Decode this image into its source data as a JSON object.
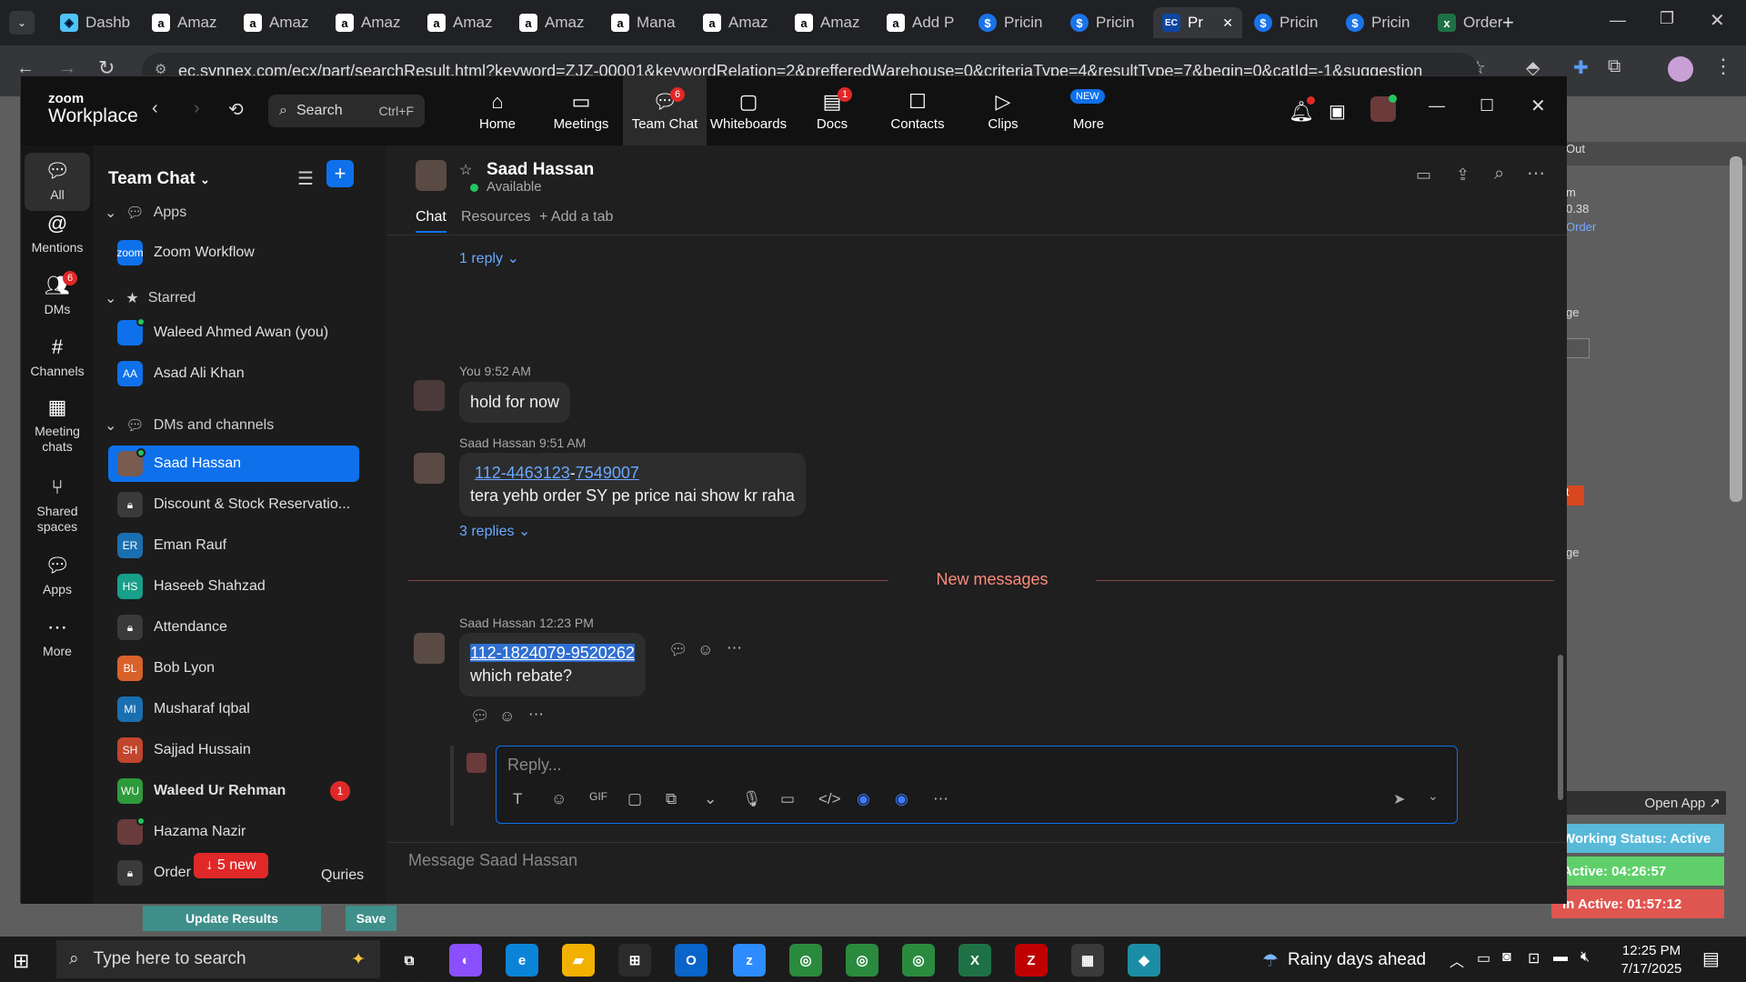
{
  "browser": {
    "tabs": [
      {
        "label": "Dashb",
        "icon": "dashboard-icon"
      },
      {
        "label": "Amaz",
        "icon": "amazon-icon"
      },
      {
        "label": "Amaz",
        "icon": "amazon-icon"
      },
      {
        "label": "Amaz",
        "icon": "amazon-icon"
      },
      {
        "label": "Amaz",
        "icon": "amazon-icon"
      },
      {
        "label": "Amaz",
        "icon": "amazon-icon"
      },
      {
        "label": "Mana",
        "icon": "amazon-icon"
      },
      {
        "label": "Amaz",
        "icon": "amazon-icon"
      },
      {
        "label": "Amaz",
        "icon": "amazon-icon"
      },
      {
        "label": "Add P",
        "icon": "amazon-icon"
      },
      {
        "label": "Pricin",
        "icon": "dollar-icon"
      },
      {
        "label": "Pricin",
        "icon": "dollar-icon"
      },
      {
        "label": "Pr",
        "icon": "ec-icon"
      },
      {
        "label": "Pricin",
        "icon": "dollar-icon"
      },
      {
        "label": "Pricin",
        "icon": "dollar-icon"
      },
      {
        "label": "Order",
        "icon": "excel-icon"
      }
    ],
    "url": "ec.synnex.com/ecx/part/searchResult.html?keyword=ZJZ-00001&keywordRelation=2&prefferedWarehouse=0&criteriaType=4&resultType=7&begin=0&catId=-1&suggestion"
  },
  "webpage": {
    "out_label": "Out",
    "price_fragment": "0.38",
    "order_link": "Order",
    "m_label": "m",
    "ge_label": "ge",
    "ge2_label": "ge",
    "t_label": "t",
    "open_app": "Open App ↗",
    "working_status": "Working Status: Active",
    "active_time": "Active: 04:26:57",
    "inactive_time": "In Active: 01:57:12",
    "update_results": "Update Results",
    "save": "Save"
  },
  "zoom": {
    "logo_top": "zoom",
    "logo_bottom": "Workplace",
    "search_label": "Search",
    "search_shortcut": "Ctrl+F",
    "nav": [
      {
        "label": "Home",
        "icon": "home-icon"
      },
      {
        "label": "Meetings",
        "icon": "video-icon"
      },
      {
        "label": "Team Chat",
        "icon": "chat-icon",
        "badge": "6"
      },
      {
        "label": "Whiteboards",
        "icon": "whiteboard-icon"
      },
      {
        "label": "Docs",
        "icon": "docs-icon",
        "badge": "1"
      },
      {
        "label": "Contacts",
        "icon": "contacts-icon"
      },
      {
        "label": "Clips",
        "icon": "clips-icon"
      },
      {
        "label": "More",
        "icon": "more-icon",
        "badge": "NEW"
      }
    ],
    "rail": [
      {
        "label": "All",
        "icon": "chat-bubble-icon"
      },
      {
        "label": "Mentions",
        "icon": "at-icon"
      },
      {
        "label": "DMs",
        "icon": "people-icon",
        "badge": "6"
      },
      {
        "label": "Channels",
        "icon": "hash-icon"
      },
      {
        "label": "Meeting chats",
        "icon": "calendar-icon"
      },
      {
        "label": "Shared spaces",
        "icon": "share-icon"
      },
      {
        "label": "Apps",
        "icon": "apps-icon"
      },
      {
        "label": "More",
        "icon": "ellipsis-icon"
      }
    ],
    "sidebar": {
      "title": "Team Chat",
      "sections": {
        "apps": "Apps",
        "starred": "Starred",
        "dms": "DMs and channels"
      },
      "apps": [
        {
          "label": "Zoom Workflow",
          "initials": "zoom"
        }
      ],
      "starred": [
        {
          "label": "Waleed Ahmed Awan (you)",
          "initials": ""
        },
        {
          "label": "Asad Ali Khan",
          "initials": "AA"
        }
      ],
      "dms": [
        {
          "label": "Saad Hassan",
          "initials": "",
          "color": "#7a5b4f"
        },
        {
          "label": "Discount & Stock Reservatio...",
          "initials": "🔒",
          "color": "#3a3a3a"
        },
        {
          "label": "Eman Rauf",
          "initials": "ER",
          "color": "#1a6fb0"
        },
        {
          "label": "Haseeb Shahzad",
          "initials": "HS",
          "color": "#18a08a"
        },
        {
          "label": "Attendance",
          "initials": "🔒",
          "color": "#3a3a3a"
        },
        {
          "label": "Bob Lyon",
          "initials": "BL",
          "color": "#d9622b"
        },
        {
          "label": "Musharaf Iqbal",
          "initials": "MI",
          "color": "#1a6fb0"
        },
        {
          "label": "Sajjad Hussain",
          "initials": "SH",
          "color": "#c2452d"
        },
        {
          "label": "Waleed Ur Rehman",
          "initials": "WU",
          "color": "#2e9a3b",
          "badge": "1"
        },
        {
          "label": "Hazama Nazir",
          "initials": "",
          "color": "#6a3b3b"
        },
        {
          "label": "Order",
          "initials": "🔒",
          "color": "#3a3a3a"
        }
      ],
      "dm_tail": "Quries",
      "new_pill": "↓ 5 new"
    },
    "chat": {
      "contact_name": "Saad Hassan",
      "status": "Available",
      "tabs": [
        "Chat",
        "Resources",
        "+ Add a tab"
      ],
      "top_reply": "1 reply ⌄",
      "messages": [
        {
          "sender": "You",
          "time": "9:52 AM",
          "text": "hold for now"
        },
        {
          "sender": "Saad Hassan",
          "time": "9:51 AM",
          "link1": "112-4463123",
          "sep": "-",
          "link2": "7549007",
          "text": "tera yehb order SY pe price nai show kr raha",
          "replies": "3 replies ⌄"
        },
        {
          "sender": "Saad Hassan",
          "time": "12:23 PM",
          "link1": "112-1824079-9520262",
          "text": "which rebate?"
        }
      ],
      "divider": "New messages",
      "reply_placeholder": "Reply...",
      "composer_placeholder": "Message Saad Hassan"
    }
  },
  "taskbar": {
    "search": "Type here to search",
    "weather": "Rainy days ahead",
    "time": "12:25 PM",
    "date": "7/17/2025"
  }
}
